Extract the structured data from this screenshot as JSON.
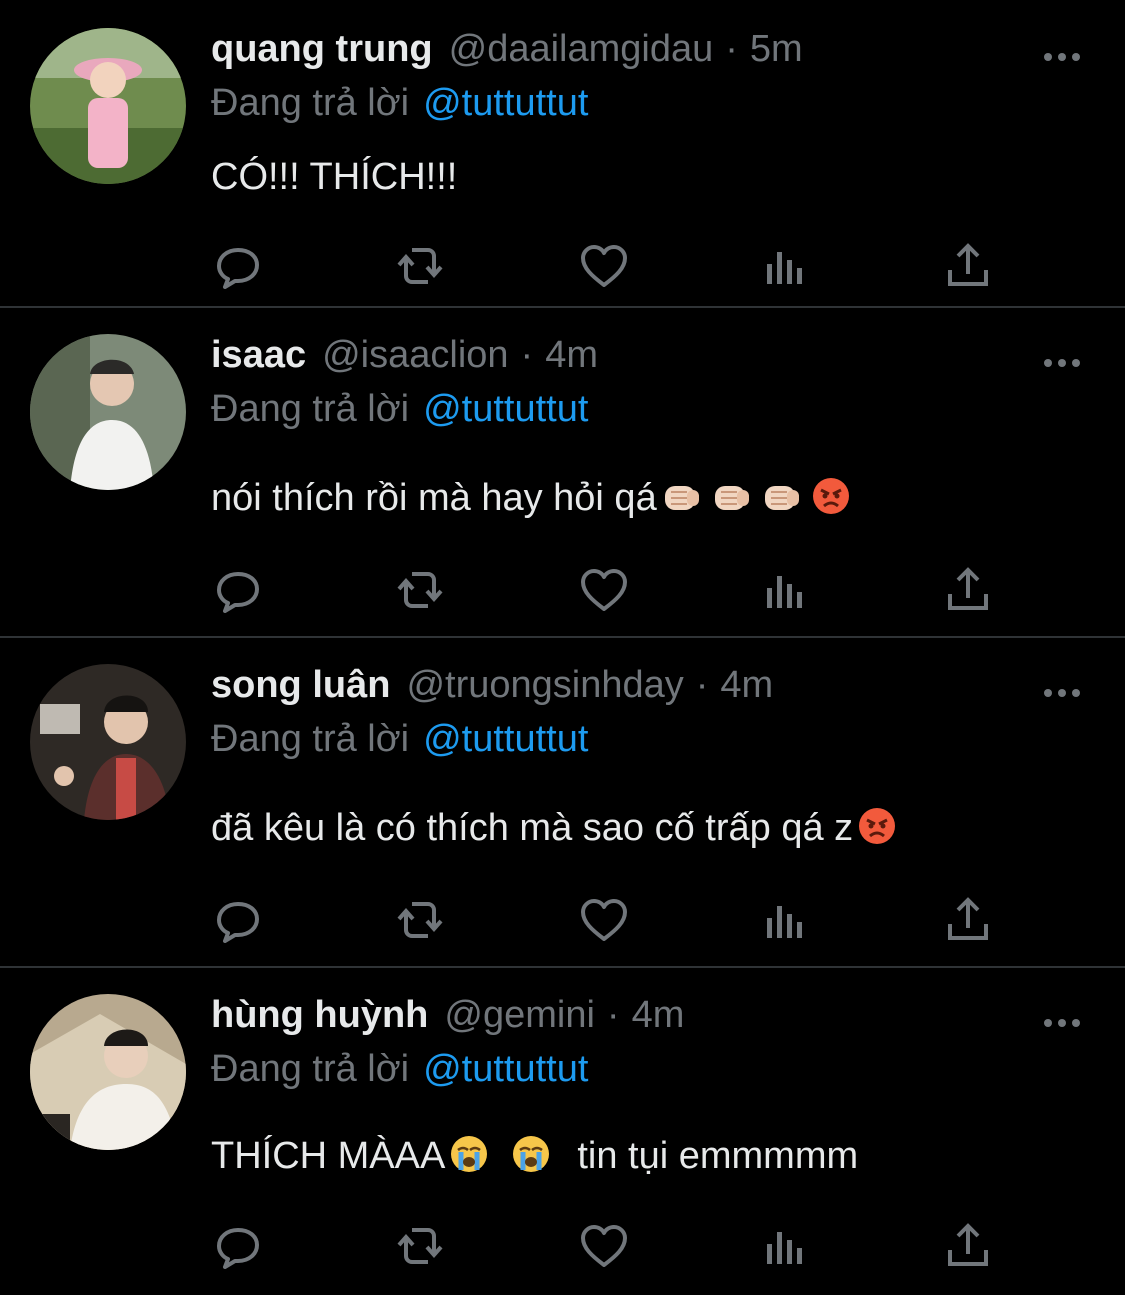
{
  "tweets": [
    {
      "name": "quang trung",
      "handle": "@daailamgidau",
      "separator": "·",
      "time": "5m",
      "reply_prefix": "Đang trả lời",
      "reply_to": "@tuttuttut",
      "text": "CÓ!!! THÍCH!!!",
      "emojis": []
    },
    {
      "name": "isaac",
      "handle": "@isaaclion",
      "separator": "·",
      "time": "4m",
      "reply_prefix": "Đang trả lời",
      "reply_to": "@tuttuttut",
      "text": "nói thích rồi mà hay hỏi qá",
      "emojis": [
        "oncoming-fist",
        "oncoming-fist",
        "oncoming-fist",
        "angry-face"
      ]
    },
    {
      "name": "song luân",
      "handle": "@truongsinhday",
      "separator": "·",
      "time": "4m",
      "reply_prefix": "Đang trả lời",
      "reply_to": "@tuttuttut",
      "text": "đã kêu là có thích mà sao cố trấp qá z",
      "emojis": [
        "angry-face"
      ]
    },
    {
      "name": "hùng huỳnh",
      "handle": "@gemini",
      "separator": "·",
      "time": "4m",
      "reply_prefix": "Đang trả lời",
      "reply_to": "@tuttuttut",
      "text": "THÍCH MÀAA",
      "text_after": "tin tụi emmmmm",
      "emojis": [
        "crying-face",
        "crying-face"
      ]
    }
  ],
  "icons": [
    "reply-icon",
    "retweet-icon",
    "like-icon",
    "analytics-icon",
    "share-icon",
    "more-icon"
  ],
  "colors": {
    "background": "#000000",
    "text": "#e7e9ea",
    "muted": "#71767b",
    "accent": "#1d9bf0",
    "divider": "#2f3336"
  }
}
